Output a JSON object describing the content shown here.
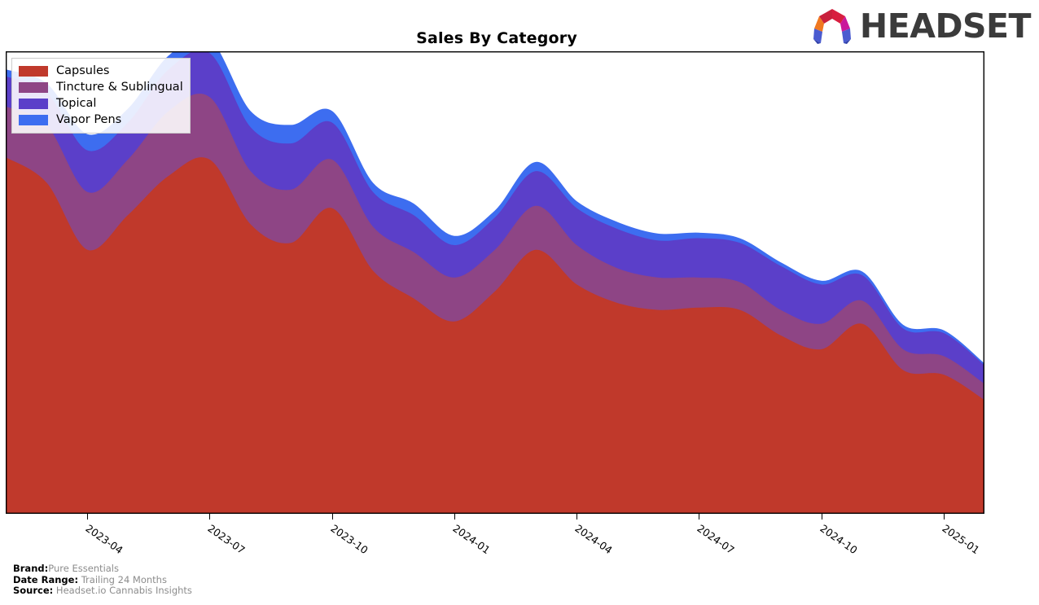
{
  "header": {
    "title": "Sales By Category",
    "logo_text": "HEADSET",
    "logo_icon": "headset-arch-logo"
  },
  "legend": {
    "position": "upper-left",
    "items": [
      {
        "label": "Capsules",
        "color": "#c0392b"
      },
      {
        "label": "Tincture & Sublingual",
        "color": "#8e4585"
      },
      {
        "label": "Topical",
        "color": "#5b3fc9"
      },
      {
        "label": "Vapor Pens",
        "color": "#3d6df0"
      }
    ]
  },
  "footer": {
    "rows": [
      {
        "key": "Brand:",
        "value": "Pure Essentials"
      },
      {
        "key": "Date Range:",
        "value": "Trailing 24 Months"
      },
      {
        "key": "Source:",
        "value": "Headset.io Cannabis Insights"
      }
    ]
  },
  "chart_data": {
    "type": "area",
    "stacked": true,
    "title": "Sales By Category",
    "xlabel": "",
    "ylabel": "",
    "grid": false,
    "legend_position": "upper-left",
    "x_tick_labels": [
      "2023-04",
      "2023-07",
      "2023-10",
      "2024-01",
      "2024-04",
      "2024-07",
      "2024-10",
      "2025-01"
    ],
    "x_tick_positions": [
      0.0833,
      0.2083,
      0.3333,
      0.4583,
      0.5833,
      0.7083,
      0.8333,
      0.9583
    ],
    "x": [
      "2023-02",
      "2023-03",
      "2023-04",
      "2023-05",
      "2023-06",
      "2023-07",
      "2023-08",
      "2023-09",
      "2023-10",
      "2023-11",
      "2023-12",
      "2024-01",
      "2024-02",
      "2024-03",
      "2024-04",
      "2024-05",
      "2024-06",
      "2024-07",
      "2024-08",
      "2024-09",
      "2024-10",
      "2024-11",
      "2024-12",
      "2025-01"
    ],
    "ylim": [
      0,
      100
    ],
    "series": [
      {
        "name": "Capsules",
        "color": "#c0392b",
        "values": [
          77.0,
          71.5,
          57.0,
          64.5,
          73.0,
          76.5,
          62.5,
          58.5,
          66.0,
          52.5,
          46.5,
          41.5,
          48.0,
          57.0,
          49.5,
          45.5,
          44.0,
          44.5,
          44.0,
          38.5,
          35.5,
          41.0,
          31.0,
          30.0,
          24.5
        ]
      },
      {
        "name": "Tincture & Sublingual",
        "color": "#8e4585",
        "values": [
          11.0,
          12.5,
          12.5,
          12.0,
          14.0,
          13.5,
          11.5,
          11.5,
          10.5,
          9.5,
          10.0,
          9.5,
          9.0,
          9.5,
          8.5,
          7.5,
          7.0,
          6.5,
          6.0,
          5.5,
          5.5,
          5.0,
          4.5,
          4.0,
          3.5
        ]
      },
      {
        "name": "Topical",
        "color": "#5b3fc9",
        "values": [
          6.5,
          7.0,
          9.0,
          8.0,
          9.0,
          9.5,
          9.5,
          10.0,
          8.0,
          7.5,
          8.0,
          7.0,
          7.0,
          7.5,
          8.0,
          8.5,
          8.0,
          8.5,
          8.5,
          9.5,
          8.5,
          5.5,
          4.5,
          5.0,
          4.0
        ]
      },
      {
        "name": "Vapor Pens",
        "color": "#3d6df0",
        "values": [
          1.5,
          2.0,
          3.5,
          3.0,
          3.0,
          3.0,
          3.5,
          4.0,
          2.5,
          2.0,
          2.5,
          2.0,
          1.5,
          2.0,
          1.5,
          1.5,
          1.5,
          1.2,
          1.0,
          0.8,
          0.8,
          0.8,
          0.8,
          0.6,
          0.4
        ]
      }
    ]
  }
}
